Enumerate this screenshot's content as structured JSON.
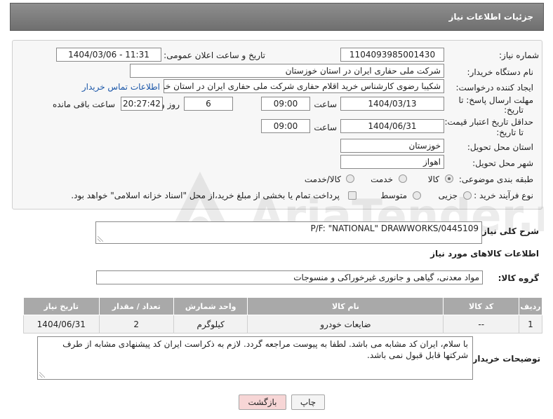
{
  "header": {
    "title": "جزئیات اطلاعات نیاز"
  },
  "form": {
    "need_number_label": "شماره نیاز:",
    "need_number": "1104093985001430",
    "announce_label": "تاریخ و ساعت اعلان عمومی:",
    "announce_value": "1404/03/06 - 11:31",
    "buyer_org_label": "نام دستگاه خریدار:",
    "buyer_org": "شرکت ملی حفاری ایران در استان خوزستان",
    "creator_label": "ایجاد کننده درخواست:",
    "creator": "شکیبا رضوی کارشناس خرید اقلام حفاری شرکت ملی حفاری ایران در استان خو",
    "contact_link": "اطلاعات تماس خریدار",
    "deadline_label_1": "مهلت ارسال پاسخ: تا",
    "deadline_label_2": "تاریخ:",
    "deadline_date": "1404/03/13",
    "time_word": "ساعت",
    "deadline_time": "09:00",
    "days": "6",
    "days_word": "روز و",
    "remaining_time": "20:27:42",
    "remaining_word": "ساعت باقی مانده",
    "price_label_1": "حداقل تاریخ اعتبار قیمت:",
    "price_label_2": "تا تاریخ:",
    "price_date": "1404/06/31",
    "price_time": "09:00",
    "province_label": "استان محل تحویل:",
    "province": "خوزستان",
    "city_label": "شهر محل تحویل:",
    "city": "اهواز",
    "category_label": "طبقه بندی موضوعی:",
    "category_options": [
      "کالا",
      "خدمت",
      "کالا/خدمت"
    ],
    "category_selected": "کالا",
    "process_label": "نوع فرآیند خرید :",
    "process_options": [
      "جزیی",
      "متوسط"
    ],
    "payment_note": "پرداخت تمام یا بخشی از مبلغ خرید،از محل \"اسناد خزانه اسلامی\" خواهد بود."
  },
  "description": {
    "label": "شرح کلی نیاز:",
    "value": "P/F: \"NATIONAL\" DRAWWORKS/0445109"
  },
  "goods": {
    "section_title": "اطلاعات کالاهای مورد نیاز",
    "group_label": "گروه کالا:",
    "group_value": "مواد معدنی، گیاهی و جانوری غیرخوراکی و منسوجات",
    "columns": [
      "ردیف",
      "کد کالا",
      "نام کالا",
      "واحد شمارش",
      "تعداد / مقدار",
      "تاریخ نیاز"
    ],
    "rows": [
      {
        "row": "1",
        "code": "--",
        "name": "ضایعات خودرو",
        "unit": "کیلوگرم",
        "qty": "2",
        "date": "1404/06/31"
      }
    ]
  },
  "buyer_notes": {
    "label": "توضیحات خریدار:",
    "value": "با سلام، ایران کد مشابه می باشد. لطفا به پیوست مراجعه گردد. لازم به ذکراست ایران کد پیشنهادی مشابه از طرف شرکتها قابل قبول نمی باشد."
  },
  "buttons": {
    "print": "چاپ",
    "back": "بازگشت"
  },
  "watermark": "AriaTender.neT",
  "colors": {
    "header": "#7d7d7d",
    "table_header": "#a9a9a9",
    "link": "#1a56a8",
    "back_button": "#f7d6d6"
  }
}
